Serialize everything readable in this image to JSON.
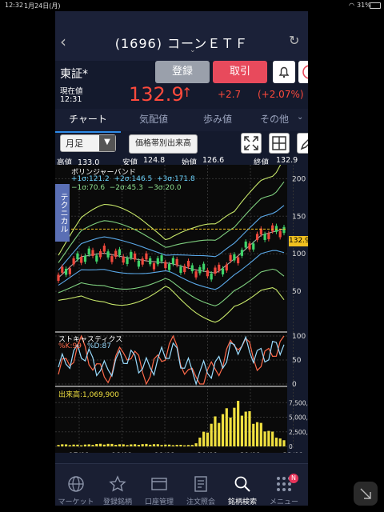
{
  "status_bar": {
    "time": "12:32",
    "date": "1月24日(月)",
    "battery": "31%"
  },
  "header": {
    "title": "(1696) コーンＥＴＦ"
  },
  "quote_bar": {
    "market": "東証*",
    "register_label": "登録",
    "trade_label": "取引"
  },
  "price": {
    "label": "現在値",
    "time": "12:31",
    "value": "132.9",
    "change": "+2.7",
    "change_pct": "(+2.07%)"
  },
  "tabs": [
    "チャート",
    "気配値",
    "歩み値",
    "その他"
  ],
  "toolbar": {
    "period": "月足",
    "volume_profile_label": "価格帯別出来高"
  },
  "ohlc": {
    "high_label": "高値",
    "high": "133.0",
    "low_label": "安値",
    "low": "124.8",
    "open_label": "始値",
    "open": "126.6",
    "close_label": "終値",
    "close": "132.9"
  },
  "bollinger": {
    "title": "ボリンジャーバンド",
    "line1": "+1σ:121.2  +2σ:146.5  +3σ:171.8",
    "line2": "−1σ:70.6  −2σ:45.3  −3σ:20.0"
  },
  "technical_label": "テクニカル",
  "stochastics": {
    "title": "ストキャスティクス",
    "k": "%K:99",
    "d": "%D:87"
  },
  "volume": {
    "title": "出来高:1,069,900"
  },
  "x_ticks": [
    "17/01",
    "18/01",
    "19/01",
    "20/01",
    "21/01",
    "22/01"
  ],
  "price_axis": [
    "200",
    "150",
    "100",
    "50"
  ],
  "stoch_axis": [
    "100",
    "50",
    "0"
  ],
  "volume_axis": [
    "7,500,000",
    "5,000,000",
    "2,500,000",
    "0"
  ],
  "current_price_tag": "132.9",
  "tabbar": [
    "マーケット",
    "登録銘柄",
    "口座管理",
    "注文照会",
    "銘柄検索",
    "メニュー"
  ],
  "menu_badge": "N",
  "colors": {
    "up": "#f0483c",
    "down": "#3fd46a",
    "accent": "#2e8be8",
    "price_up": "#ff4a3c"
  },
  "chart_data": [
    {
      "type": "line",
      "title": "ボリンジャーバンド",
      "x": [
        "17/01",
        "17/07",
        "18/01",
        "18/07",
        "19/01",
        "19/07",
        "20/01",
        "20/07",
        "21/01",
        "21/07",
        "22/01"
      ],
      "series": [
        {
          "values": [
            68,
            96,
            101,
            95,
            90,
            87,
            79,
            74,
            98,
            125,
            133
          ]
        }
      ],
      "ylim": [
        0,
        210
      ]
    },
    {
      "type": "line",
      "title": "ストキャスティクス",
      "x": [
        "17/01",
        "17/07",
        "18/01",
        "18/07",
        "19/01",
        "19/07",
        "20/01",
        "20/07",
        "21/01",
        "21/07",
        "22/01"
      ],
      "series": [
        {
          "name": "%K",
          "values": [
            20,
            85,
            10,
            75,
            15,
            90,
            5,
            30,
            95,
            40,
            99
          ]
        },
        {
          "name": "%D",
          "values": [
            35,
            70,
            25,
            60,
            30,
            75,
            20,
            35,
            85,
            55,
            87
          ]
        }
      ],
      "ylim": [
        0,
        100
      ]
    },
    {
      "type": "bar",
      "title": "出来高:1,069,900",
      "x": [
        "17/01",
        "17/07",
        "18/01",
        "18/07",
        "19/01",
        "19/07",
        "20/01",
        "20/07",
        "21/01",
        "21/07",
        "22/01"
      ],
      "values": [
        400000,
        300000,
        500000,
        350000,
        450000,
        300000,
        250000,
        5500000,
        8000000,
        4000000,
        1069900
      ],
      "ylim": [
        0,
        8500000
      ]
    }
  ]
}
